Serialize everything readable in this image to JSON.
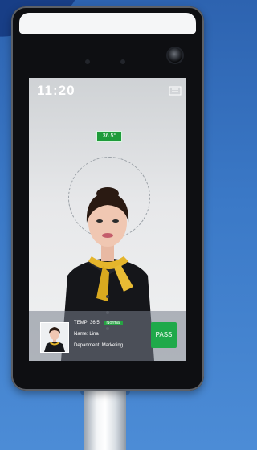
{
  "screen": {
    "time": "11:20",
    "temperature_badge": "36.5°",
    "info": {
      "temp_label": "TEMP:",
      "temp_value": "36.5",
      "temp_status": "Normal",
      "name_label": "Name:",
      "name_value": "Lina",
      "department_label": "Department:",
      "department_value": "Marketing"
    },
    "pass_label": "PASS"
  },
  "colors": {
    "accent_green": "#1fa94a",
    "background_blue": "#3b79c7",
    "device_black": "#0e0f12"
  },
  "icons": [
    "menu-icon",
    "camera-lens-icon"
  ]
}
